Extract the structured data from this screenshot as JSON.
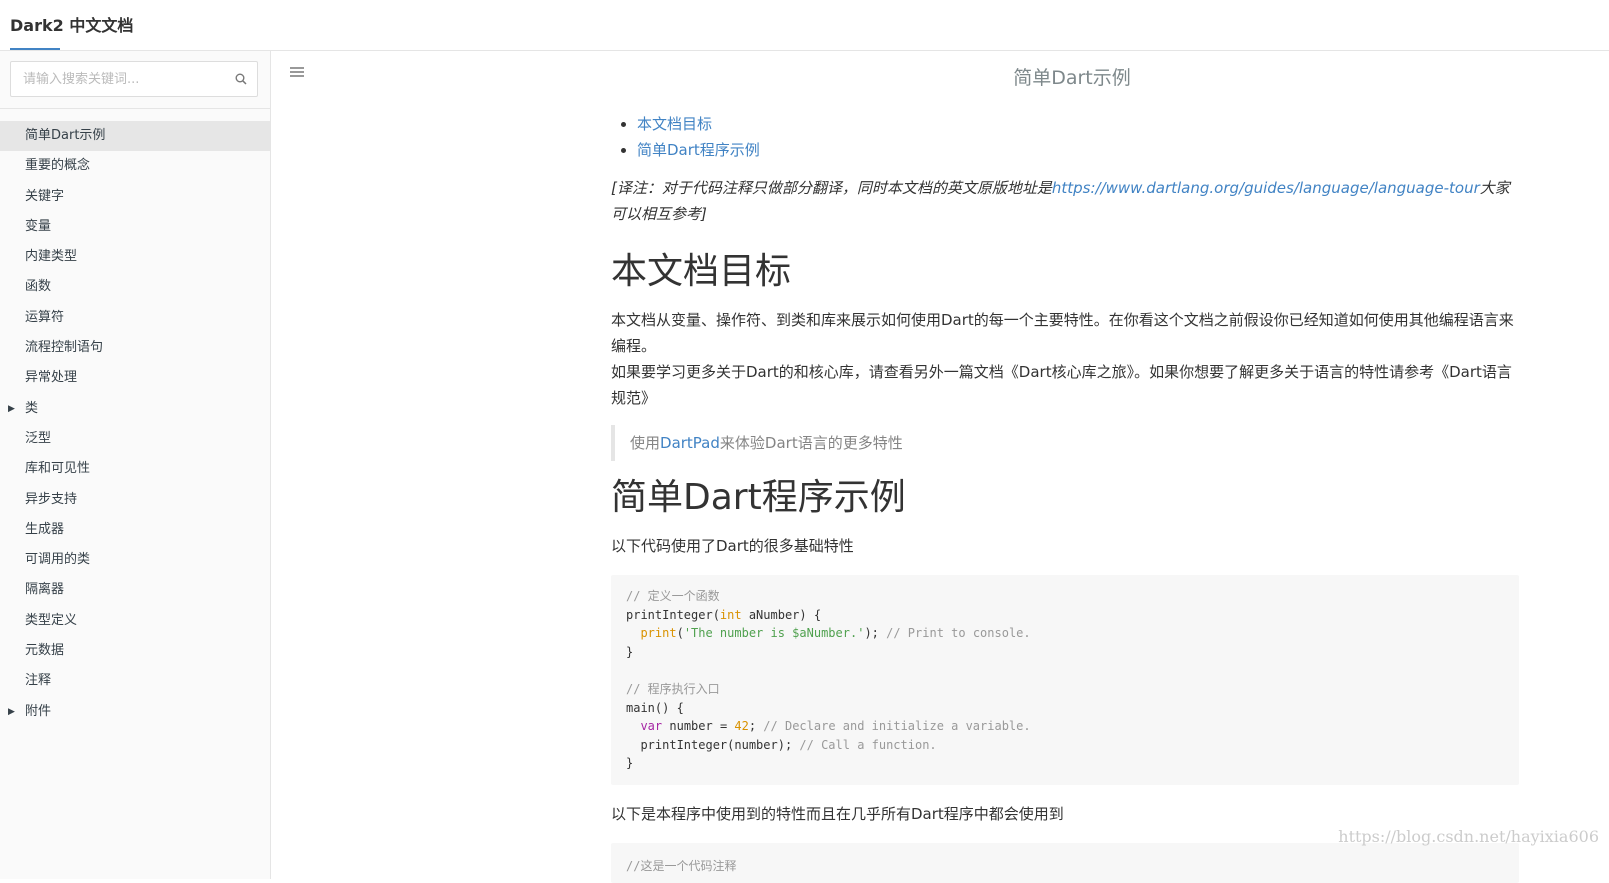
{
  "header": {
    "title": "Dark2 中文文档"
  },
  "sidebar": {
    "search_placeholder": "请输入搜索关键词...",
    "items": [
      {
        "label": "简单Dart示例"
      },
      {
        "label": "重要的概念"
      },
      {
        "label": "关键字"
      },
      {
        "label": "变量"
      },
      {
        "label": "内建类型"
      },
      {
        "label": "函数"
      },
      {
        "label": "运算符"
      },
      {
        "label": "流程控制语句"
      },
      {
        "label": "异常处理"
      },
      {
        "label": "类"
      },
      {
        "label": "泛型"
      },
      {
        "label": "库和可见性"
      },
      {
        "label": "异步支持"
      },
      {
        "label": "生成器"
      },
      {
        "label": "可调用的类"
      },
      {
        "label": "隔离器"
      },
      {
        "label": "类型定义"
      },
      {
        "label": "元数据"
      },
      {
        "label": "注释"
      },
      {
        "label": "附件"
      }
    ]
  },
  "page": {
    "title": "简单Dart示例",
    "toc": [
      "本文档目标",
      "简单Dart程序示例"
    ],
    "note_prefix": "[译注：对于代码注释只做部分翻译，同时本文档的英文原版地址是",
    "note_link": "https://www.dartlang.org/guides/language/language-tour",
    "note_suffix": "大家可以相互参考]",
    "h1_goal": "本文档目标",
    "p1": "本文档从变量、操作符、到类和库来展示如何使用Dart的每一个主要特性。在你看这个文档之前假设你已经知道如何使用其他编程语言来编程。",
    "p2": "如果要学习更多关于Dart的和核心库，请查看另外一篇文档《Dart核心库之旅》。如果你想要了解更多关于语言的特性请参考《Dart语言规范》",
    "quote_prefix": "使用",
    "quote_link": "DartPad",
    "quote_suffix": "来体验Dart语言的更多特性",
    "h1_example": "简单Dart程序示例",
    "p3": "以下代码使用了Dart的很多基础特性",
    "p4": "以下是本程序中使用到的特性而且在几乎所有Dart程序中都会使用到",
    "code2_first_line": "//这是一个代码注释"
  },
  "code": {
    "c1": "// 定义一个函数",
    "l2a": "printInteger(",
    "l2type": "int",
    "l2b": " aNumber) {",
    "l3indent": "  ",
    "l3fn": "print",
    "l3open": "(",
    "l3str": "'The number is $aNumber.'",
    "l3close": "); ",
    "l3cm": "// Print to console.",
    "l4": "}",
    "c2": "// 程序执行入口",
    "l6": "main() {",
    "l7indent": "  ",
    "l7kw": "var",
    "l7a": " number = ",
    "l7num": "42",
    "l7b": "; ",
    "l7cm": "// Declare and initialize a variable.",
    "l8a": "  printInteger(number); ",
    "l8cm": "// Call a function.",
    "l9": "}"
  },
  "watermark": "https://blog.csdn.net/hayixia606"
}
